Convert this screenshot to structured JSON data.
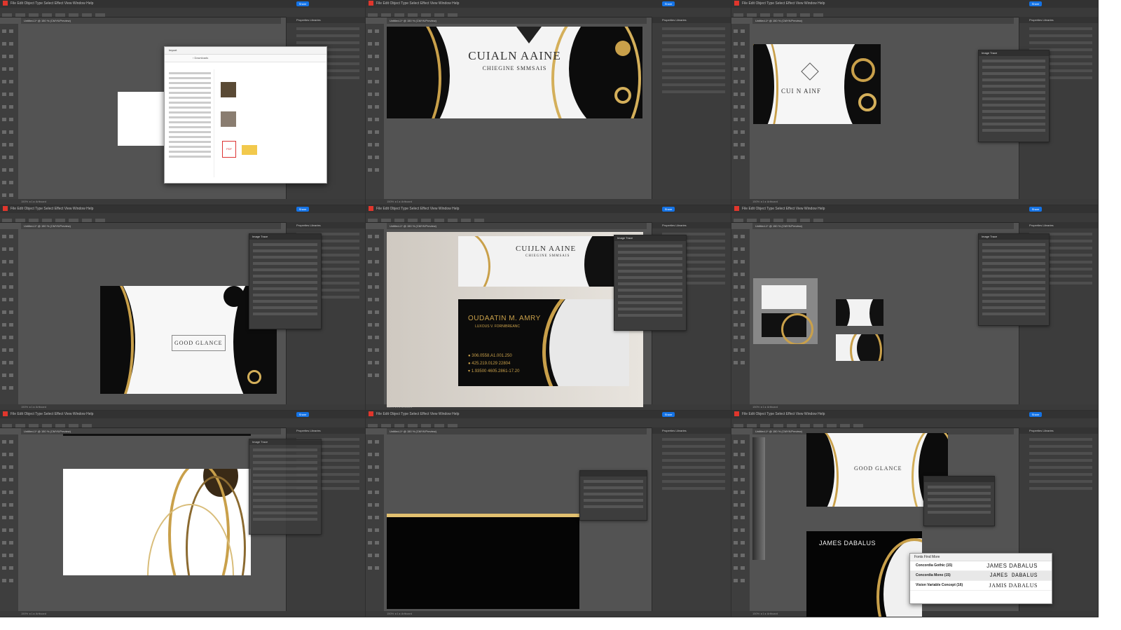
{
  "app": {
    "menu": "File  Edit  Object  Type  Select  Effect  View  Window  Help",
    "share_label": "Share",
    "doc_tab": "Untitled-1* @ 150 % (CMYK/Preview)",
    "status": "150%   ◂  1  ▸   Artboard",
    "panel_tabs": "Properties   Libraries"
  },
  "image_trace": {
    "title": "Image Trace"
  },
  "cards": {
    "c1": {
      "title": "CUIALN AAINE",
      "subtitle": "CHIEGINE SMMSAIS"
    },
    "c2": {
      "title": "CUI N AINF"
    },
    "c3": {
      "title": "GOOD GLANCE"
    },
    "c4": {
      "front_title": "CUIJLN AAINE",
      "front_sub": "CHIEGINE SMMSAIS",
      "back_name": "OUDAATIN M. AMRY",
      "back_role": "LUXOUS V. FORNIBREANC",
      "contacts": [
        "306.0558.A1.001.250",
        "425.219.0129 22804",
        "1.93500 4605.2861-17.20"
      ]
    },
    "c9_logo": "GOOD GLANCE",
    "c9_name": "JAMES DABALUS"
  },
  "font_panel": {
    "header": "Fonts    Find More",
    "rows": [
      {
        "font": "Concordia Gothic (15)",
        "sample": "JAMES DABALUS"
      },
      {
        "font": "Concordia Mono (15)",
        "sample": "JAMES DABALUS"
      },
      {
        "font": "Vision Variable Concept (16)",
        "sample": "JAMIS DABALUS"
      }
    ]
  },
  "explorer": {
    "title": "Import",
    "path": "› Downloads",
    "files": [
      "PDF",
      "Folder"
    ]
  },
  "colors": {
    "gold": "#c9a04a",
    "black": "#0b0b0b",
    "ui_dark": "#535353",
    "accent": "#1473e6"
  }
}
